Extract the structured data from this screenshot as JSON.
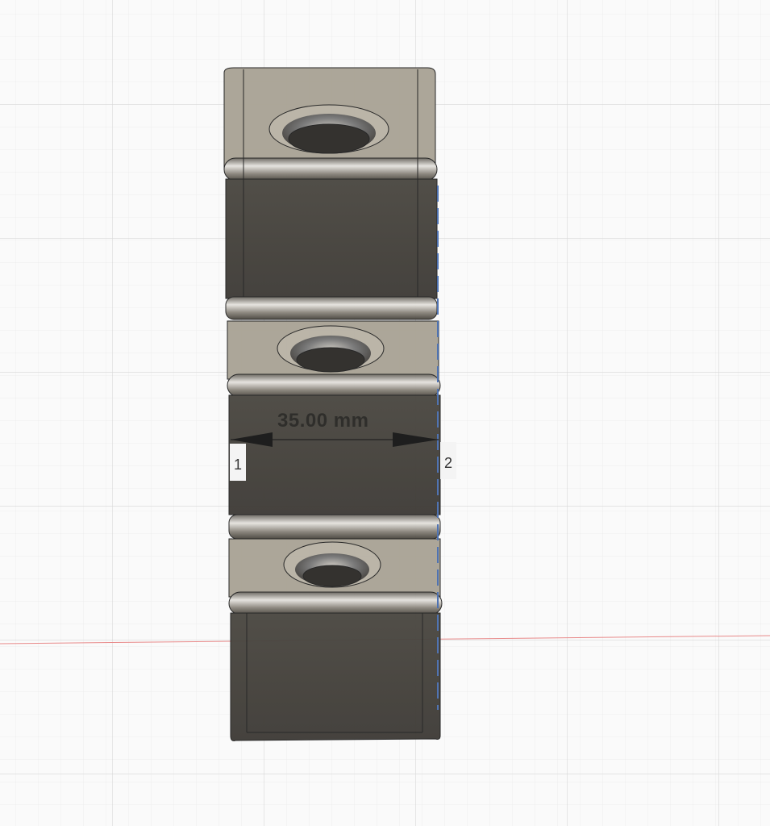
{
  "viewport": {
    "measurement": {
      "value_label": "35.00 mm",
      "point_1_label": "1",
      "point_2_label": "2"
    },
    "colors": {
      "grid_minor": "#ececec",
      "grid_major": "#d6d6d6",
      "x_axis": "#e88a8a",
      "body_top": "#a8a294",
      "body_face": "#47443e"
    }
  }
}
